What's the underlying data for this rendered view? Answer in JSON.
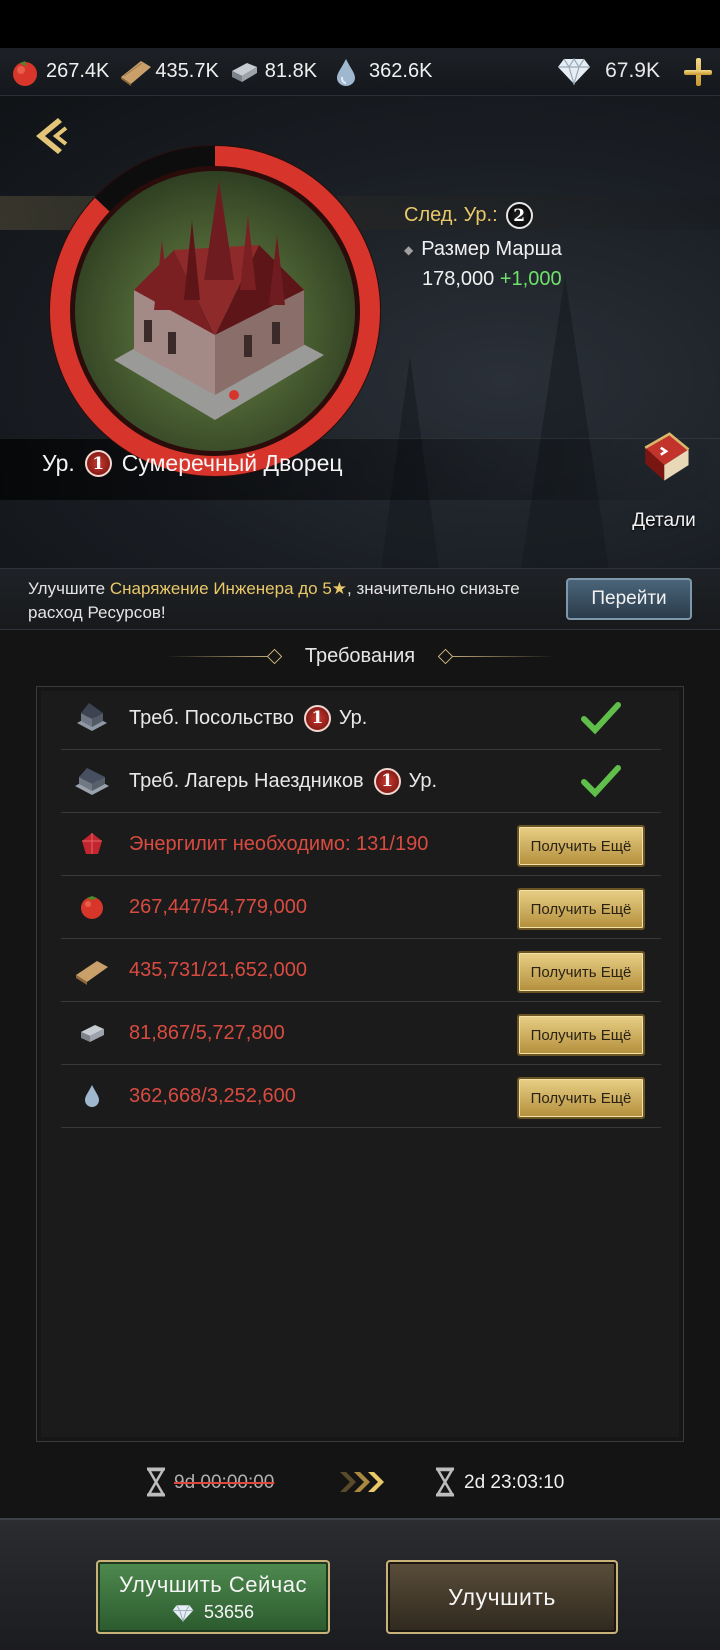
{
  "resources": {
    "food": "267.4K",
    "wood": "435.7K",
    "iron": "81.8K",
    "water": "362.6K",
    "gems": "67.9K"
  },
  "building": {
    "level_prefix": "Ур.",
    "level": "1",
    "name": "Сумеречный Дворец"
  },
  "next_level": {
    "label": "След. Ур.:",
    "level": "2",
    "stat_name": "Размер Марша",
    "stat_value": "178,000",
    "stat_increase": "+1,000"
  },
  "details_label": "Детали",
  "tip": {
    "pre": "Улучшите ",
    "highlight": "Снаряжение Инженера до 5★",
    "post": ", значительно снизьте расход Ресурсов!",
    "button": "Перейти"
  },
  "requirements_title": "Требования",
  "requirements": [
    {
      "text": "Треб. Посольство",
      "level": "1",
      "suffix": "Ур.",
      "met": true
    },
    {
      "text": "Треб. Лагерь Наездников",
      "level": "1",
      "suffix": "Ур.",
      "met": true
    },
    {
      "text": "Энергилит необходимо: 131/190",
      "met": false,
      "button": "Получить Ещё"
    },
    {
      "text": "267,447/54,779,000",
      "met": false,
      "button": "Получить Ещё"
    },
    {
      "text": "435,731/21,652,000",
      "met": false,
      "button": "Получить Ещё"
    },
    {
      "text": "81,867/5,727,800",
      "met": false,
      "button": "Получить Ещё"
    },
    {
      "text": "362,668/3,252,600",
      "met": false,
      "button": "Получить Ещё"
    }
  ],
  "timer": {
    "original": "9d 00:00:00",
    "reduced": "2d 23:03:10"
  },
  "buttons": {
    "upgrade_now": "Улучшить Сейчас",
    "upgrade_now_cost": "53656",
    "upgrade": "Улучшить"
  },
  "colors": {
    "gold": "#e9c869",
    "warning_red": "#d94b40",
    "increase_green": "#6ee06b"
  },
  "progress": {
    "ring_filled_fraction": 0.87
  }
}
